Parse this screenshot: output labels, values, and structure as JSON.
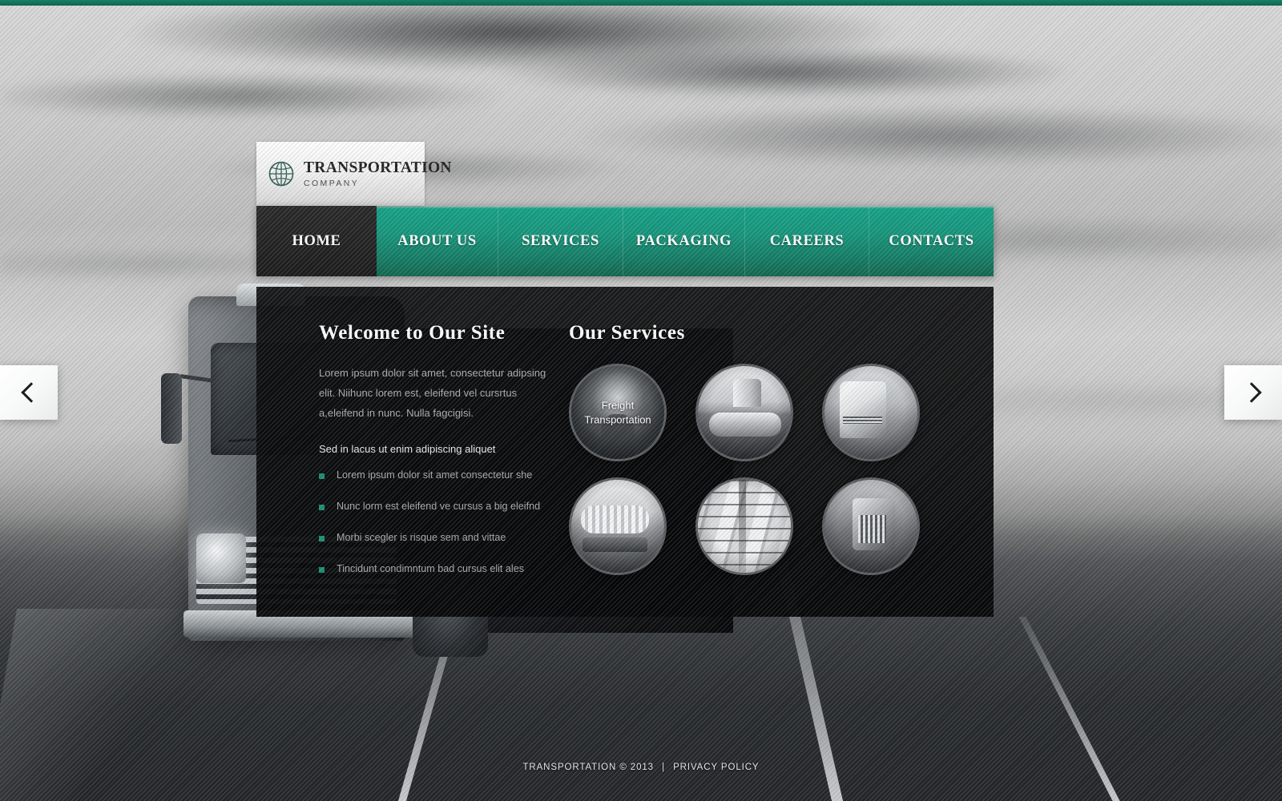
{
  "theme": {
    "accent": "#16a187",
    "accent_dark": "#13674f",
    "panel_bg": "#0b0c0d",
    "active_nav_bg": "#242424",
    "bullet_color": "#1b8f73",
    "top_bar": "#0f6450"
  },
  "logo": {
    "icon": "globe-icon",
    "title": "TRANSPORTATION",
    "subtitle": "COMPANY"
  },
  "nav": {
    "items": [
      {
        "label": "HOME",
        "active": true
      },
      {
        "label": "ABOUT US",
        "active": false
      },
      {
        "label": "SERVICES",
        "active": false
      },
      {
        "label": "PACKAGING",
        "active": false
      },
      {
        "label": "CAREERS",
        "active": false
      },
      {
        "label": "CONTACTS",
        "active": false
      }
    ]
  },
  "slider": {
    "prev_icon": "chevron-left-icon",
    "prev_label": "‹",
    "next_icon": "chevron-right-icon",
    "next_label": "›"
  },
  "welcome": {
    "title": "Welcome to Our Site",
    "paragraph": "Lorem ipsum dolor sit amet, consectetur adipsing elit. Niihunc lorem est, eleifend vel cursrtus a,eleifend in nunc. Nulla fagcigisi.",
    "subheading": "Sed in lacus ut enim adipiscing aliquet",
    "bullets": [
      "Lorem ipsum dolor sit amet consectetur she",
      "Nunc lorm est eleifend ve cursus a big eleifnd",
      "Morbi scegler is risque sem and vittae",
      "Tincidunt condimntum bad cursus elit ales"
    ]
  },
  "services": {
    "title": "Our Services",
    "items": [
      {
        "image": "driver-portrait-image",
        "label": "Freight\nTransportation",
        "has_label": true
      },
      {
        "image": "tanker-truck-silo-image",
        "label": "",
        "has_label": false
      },
      {
        "image": "white-semi-truck-image",
        "label": "",
        "has_label": false
      },
      {
        "image": "tanker-truck-side-image",
        "label": "",
        "has_label": false
      },
      {
        "image": "warehouse-pallets-image",
        "label": "",
        "has_label": false
      },
      {
        "image": "chrome-rig-truck-image",
        "label": "",
        "has_label": false
      }
    ]
  },
  "footer": {
    "copyright": "TRANSPORTATION © 2013",
    "separator": "|",
    "privacy_link": "PRIVACY POLICY"
  }
}
